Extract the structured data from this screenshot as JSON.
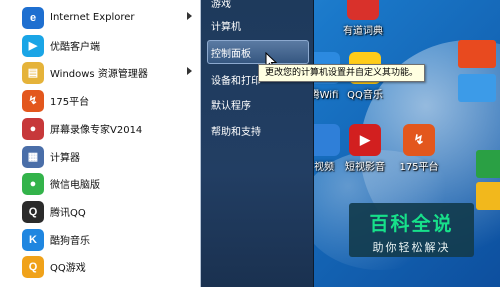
{
  "left_menu": {
    "items": [
      {
        "label": "Internet Explorer",
        "icon": "ie-icon",
        "color": "#1e6fd0",
        "glyph": "e",
        "arrow": true
      },
      {
        "label": "优酷客户端",
        "icon": "youku-icon",
        "color": "#1aa5e6",
        "glyph": "▶",
        "arrow": false
      },
      {
        "label": "Windows 资源管理器",
        "icon": "explorer-folder-icon",
        "color": "#e5b33a",
        "glyph": "▤",
        "arrow": true
      },
      {
        "label": "175平台",
        "icon": "175-icon",
        "color": "#e3571d",
        "glyph": "↯",
        "arrow": false
      },
      {
        "label": "屏幕录像专家V2014",
        "icon": "screen-recorder-icon",
        "color": "#c7383a",
        "glyph": "●",
        "arrow": false
      },
      {
        "label": "计算器",
        "icon": "calculator-icon",
        "color": "#4a6ea8",
        "glyph": "▦",
        "arrow": false
      },
      {
        "label": "微信电脑版",
        "icon": "wechat-icon",
        "color": "#33b34a",
        "glyph": "●",
        "arrow": false
      },
      {
        "label": "腾讯QQ",
        "icon": "qq-icon",
        "color": "#2b2b2b",
        "glyph": "Q",
        "arrow": false
      },
      {
        "label": "酷狗音乐",
        "icon": "kugou-icon",
        "color": "#1f86e0",
        "glyph": "K",
        "arrow": false
      },
      {
        "label": "QQ游戏",
        "icon": "qq-game-icon",
        "color": "#f0a21a",
        "glyph": "Q",
        "arrow": false
      }
    ]
  },
  "right_menu": {
    "items": [
      {
        "label": "游戏"
      },
      {
        "label": "计算机"
      },
      {
        "label": "控制面板",
        "selected": true
      },
      {
        "label": "设备和打印"
      },
      {
        "label": "默认程序"
      },
      {
        "label": "帮助和支持"
      }
    ]
  },
  "tooltip": {
    "text": "更改您的计算机设置并自定义其功能。"
  },
  "desktop_icons": [
    {
      "label": "有道词典",
      "icon": "youdao-icon",
      "color": "#d9312b",
      "glyph": ""
    },
    {
      "label": "腾Wifi",
      "icon": "wifi-icon",
      "color": "#2c8ae0",
      "glyph": ""
    },
    {
      "label": "QQ音乐",
      "icon": "qq-music-icon",
      "color": "#ffcc1a",
      "glyph": ""
    },
    {
      "label": "视频",
      "icon": "video-icon",
      "color": "#2f7fd8",
      "glyph": ""
    },
    {
      "label": "短视影音",
      "icon": "media-player-icon",
      "color": "#d21f1f",
      "glyph": "▶"
    },
    {
      "label": "175平台",
      "icon": "175-desktop-icon",
      "color": "#e3571d",
      "glyph": "↯"
    }
  ],
  "watermark": {
    "title": "百科全说",
    "subtitle": "助你轻松解决"
  }
}
